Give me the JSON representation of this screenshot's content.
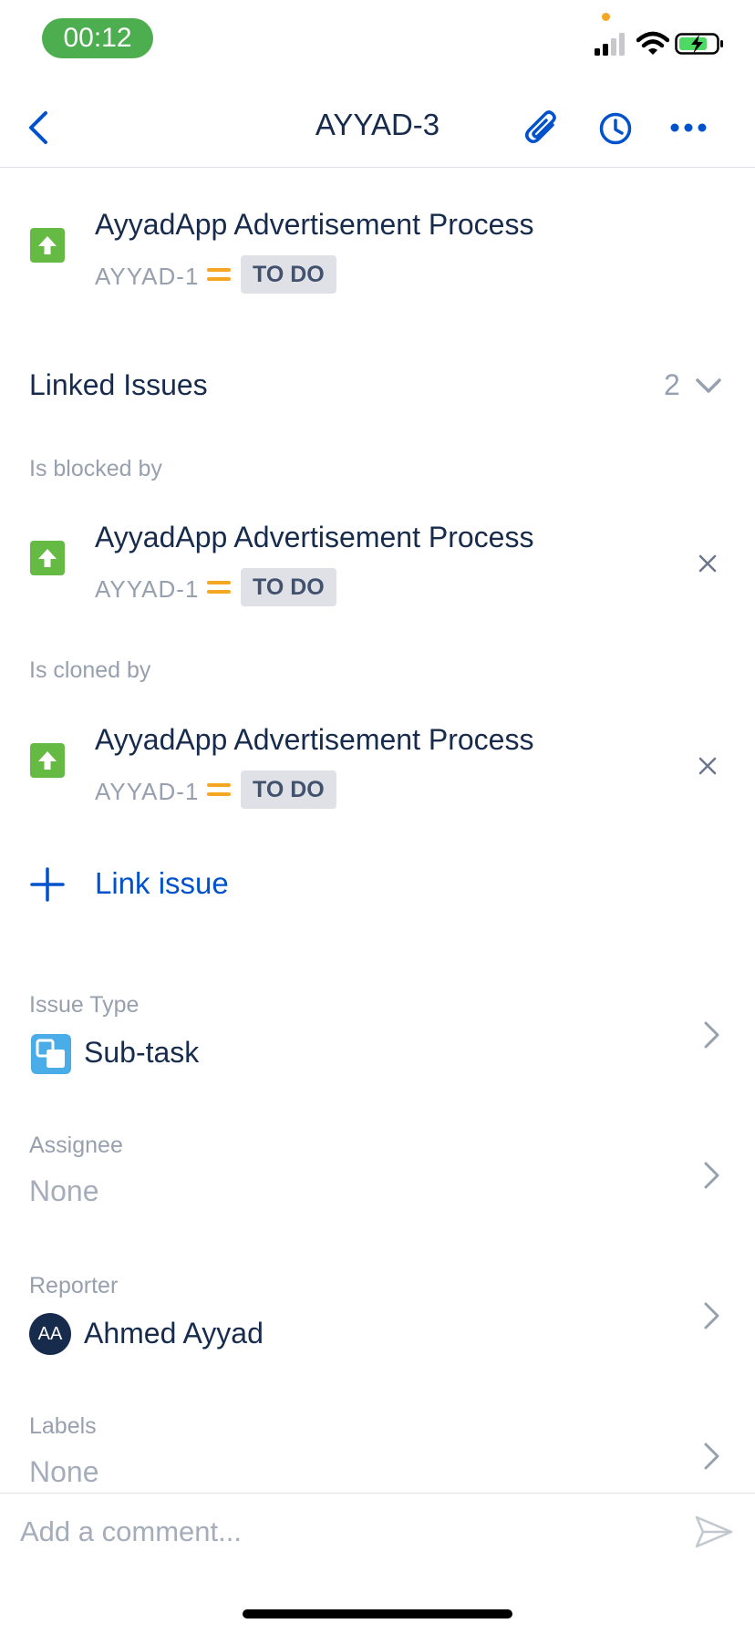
{
  "status_bar": {
    "time": "00:12"
  },
  "header": {
    "title": "AYYAD-3"
  },
  "parent_issue": {
    "title": "AyyadApp Advertisement Process",
    "key": "AYYAD-1",
    "status": "TO DO"
  },
  "linked_issues": {
    "title": "Linked Issues",
    "count": "2",
    "groups": [
      {
        "label": "Is blocked by",
        "issue": {
          "title": "AyyadApp Advertisement Process",
          "key": "AYYAD-1",
          "status": "TO DO"
        }
      },
      {
        "label": "Is cloned by",
        "issue": {
          "title": "AyyadApp Advertisement Process",
          "key": "AYYAD-1",
          "status": "TO DO"
        }
      }
    ],
    "link_label": "Link issue"
  },
  "fields": {
    "issue_type": {
      "label": "Issue Type",
      "value": "Sub-task"
    },
    "assignee": {
      "label": "Assignee",
      "value": "None"
    },
    "reporter": {
      "label": "Reporter",
      "value": "Ahmed Ayyad",
      "initials": "AA"
    },
    "labels": {
      "label": "Labels",
      "value": "None"
    }
  },
  "comment": {
    "placeholder": "Add a comment..."
  },
  "colors": {
    "accent": "#0052cc",
    "issue_icon": "#65ba43",
    "priority": "#f5a623",
    "status_time_bg": "#4cae4f"
  },
  "icons": [
    "back-icon",
    "attachment-icon",
    "history-icon",
    "more-icon",
    "story-icon",
    "priority-medium-icon",
    "chevron-down-icon",
    "close-icon",
    "plus-icon",
    "subtask-icon",
    "chevron-right-icon",
    "send-icon"
  ]
}
